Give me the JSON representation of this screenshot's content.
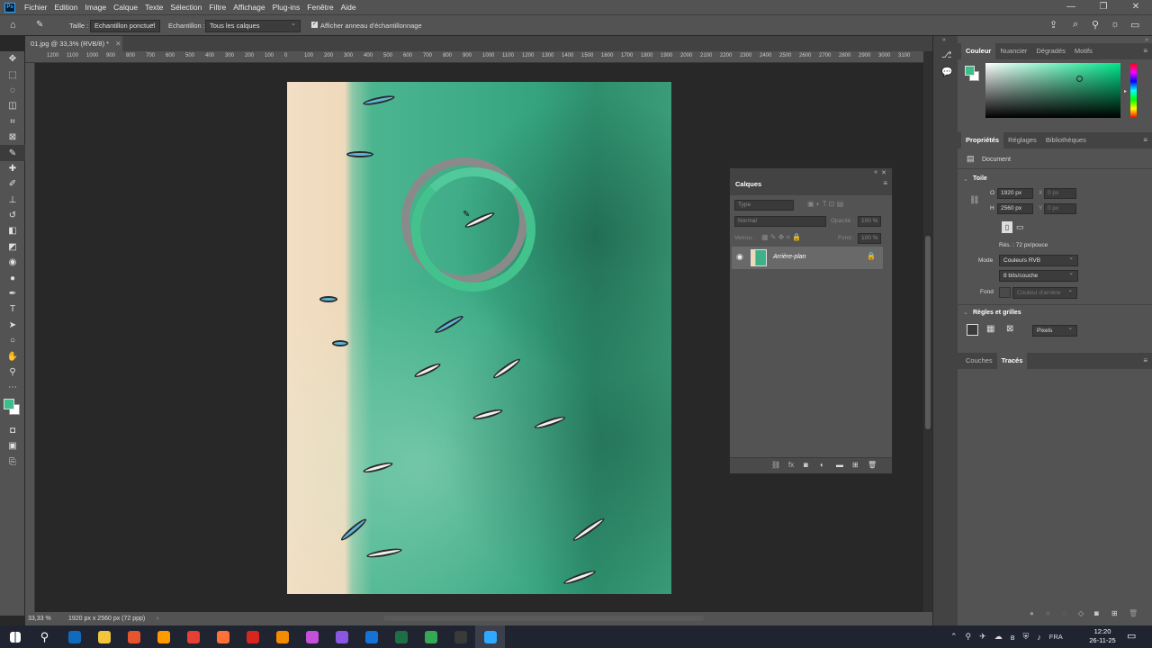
{
  "menubar": {
    "app_icon": "Ps",
    "items": [
      "Fichier",
      "Edition",
      "Image",
      "Calque",
      "Texte",
      "Sélection",
      "Filtre",
      "Affichage",
      "Plug-ins",
      "Fenêtre",
      "Aide"
    ]
  },
  "options": {
    "size_label": "Taille :",
    "size_value": "Echantillon ponctuel",
    "sample_label": "Echantillon :",
    "sample_value": "Tous les calques",
    "ring_label": "Afficher anneau d'échantillonnage"
  },
  "document": {
    "tab_title": "01.jpg @ 33,3% (RVB/8) *",
    "zoom": "33,33 %",
    "doc_info": "1920 px x 2560 px (72 ppp)"
  },
  "ruler": {
    "ticks": [
      "1200",
      "1100",
      "1000",
      "900",
      "800",
      "700",
      "600",
      "500",
      "400",
      "300",
      "200",
      "100",
      "0",
      "100",
      "200",
      "300",
      "400",
      "500",
      "600",
      "700",
      "800",
      "900",
      "1000",
      "1100",
      "1200",
      "1300",
      "1400",
      "1500",
      "1600",
      "1700",
      "1800",
      "1900",
      "2000",
      "2100",
      "2200",
      "2300",
      "2400",
      "2500",
      "2600",
      "2700",
      "2800",
      "2900",
      "3000",
      "3100"
    ]
  },
  "color_panel": {
    "tabs": [
      "Couleur",
      "Nuancier",
      "Dégradés",
      "Motifs"
    ],
    "foreground": "#3dbd8a"
  },
  "properties_panel": {
    "tabs": [
      "Propriétés",
      "Réglages",
      "Bibliothèques"
    ],
    "kind": "Document",
    "section_canvas": "Toile",
    "w_label": "O",
    "w_value": "1920 px",
    "h_label": "H",
    "h_value": "2560 px",
    "x_label": "X",
    "x_placeholder": "0 px",
    "y_label": "Y",
    "y_placeholder": "0 px",
    "resolution": "Rés. : 72 px/pouce",
    "mode_label": "Mode",
    "mode_value": "Couleurs RVB",
    "bits_value": "8 bits/couche",
    "fill_label": "Fond",
    "fill_value": "Couleur d'arrière",
    "section_rulers": "Règles et grilles",
    "units_value": "Pixels"
  },
  "paths_panel": {
    "tabs": [
      "Couches",
      "Tracés"
    ]
  },
  "layers_panel": {
    "title": "Calques",
    "search_placeholder": "Type",
    "blend_mode": "Normal",
    "opacity_label": "Opacité :",
    "opacity_value": "100 %",
    "lock_label": "Verrou :",
    "fill_label": "Fond :",
    "fill_value": "100 %",
    "layers": [
      {
        "name": "Arrière-plan",
        "visible": true,
        "locked": true
      }
    ]
  },
  "taskbar": {
    "language": "FRA",
    "time": "12:20",
    "date": "26-11-25",
    "apps": [
      {
        "name": "outlook-icon",
        "color": "#0f6cbd"
      },
      {
        "name": "file-explorer-icon",
        "color": "#f2c53d"
      },
      {
        "name": "ai-pattern-icon",
        "color": "#e8542d"
      },
      {
        "name": "illustrator-icon",
        "color": "#ff9a00"
      },
      {
        "name": "chrome-icon",
        "color": "#e44134"
      },
      {
        "name": "firefox-icon",
        "color": "#ff7139"
      },
      {
        "name": "acrobat-icon",
        "color": "#d7261f"
      },
      {
        "name": "vlc-icon",
        "color": "#f28b00"
      },
      {
        "name": "photos-icon",
        "color": "#c44fd8"
      },
      {
        "name": "music-icon",
        "color": "#8a56e2"
      },
      {
        "name": "mail-icon",
        "color": "#1673d6"
      },
      {
        "name": "excel-icon",
        "color": "#1d7044"
      },
      {
        "name": "chrome-alt-icon",
        "color": "#34a853"
      },
      {
        "name": "obs-icon",
        "color": "#3a3a3a"
      },
      {
        "name": "photoshop-icon",
        "color": "#31a8ff"
      }
    ]
  }
}
